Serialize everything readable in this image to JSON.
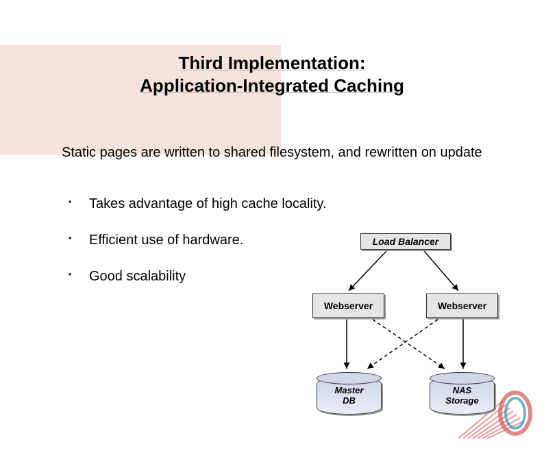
{
  "title_line1": "Third Implementation:",
  "title_line2": "Application-Integrated Caching",
  "lead": "Static pages are written to shared filesystem, and rewritten on update",
  "bullets": [
    "Takes advantage of high cache locality.",
    "Efficient use of hardware.",
    "Good scalability"
  ],
  "diagram": {
    "load_balancer": "Load Balancer",
    "webserver1": "Webserver",
    "webserver2": "Webserver",
    "master_db": "Master DB",
    "nas_storage": "NAS Storage"
  }
}
